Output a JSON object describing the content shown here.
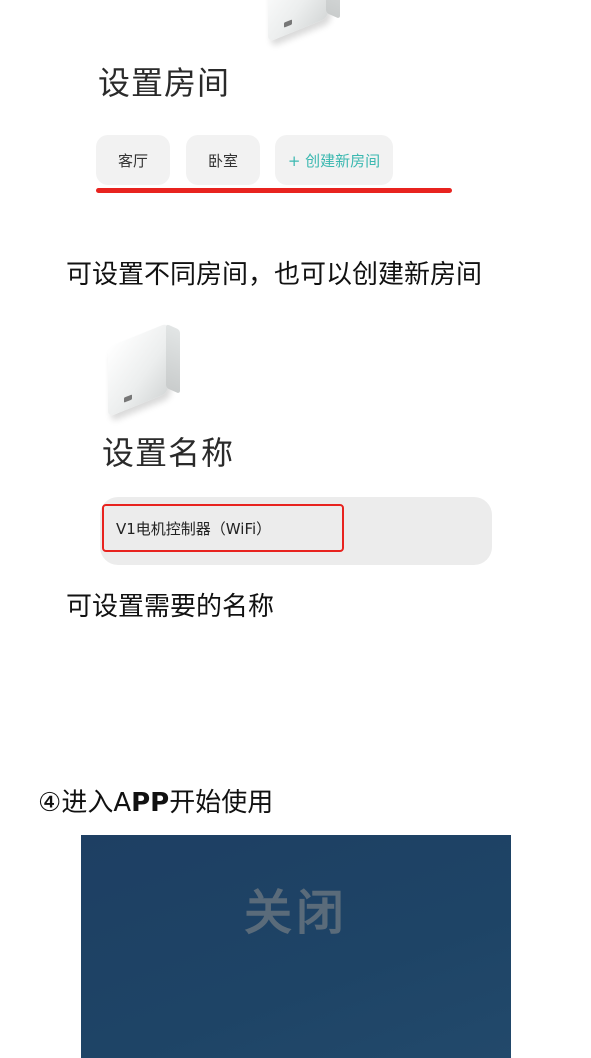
{
  "room_section": {
    "title": "设置房间",
    "rooms": [
      "客厅",
      "卧室"
    ],
    "add_room_label": "+ 创建新房间",
    "caption": "可设置不同房间，也可以创建新房间"
  },
  "name_section": {
    "title": "设置名称",
    "device_name": "V1电机控制器（WiFi）",
    "caption": "可设置需要的名称"
  },
  "step4": {
    "number": "④",
    "text_before": "进入A",
    "text_bold": "PP",
    "text_after": "开始使用"
  },
  "app_preview": {
    "close_label": "关闭",
    "bg_color": "#1e4466"
  },
  "colors": {
    "highlight_red": "#e8231f",
    "accent_teal": "#3bb8b0"
  }
}
